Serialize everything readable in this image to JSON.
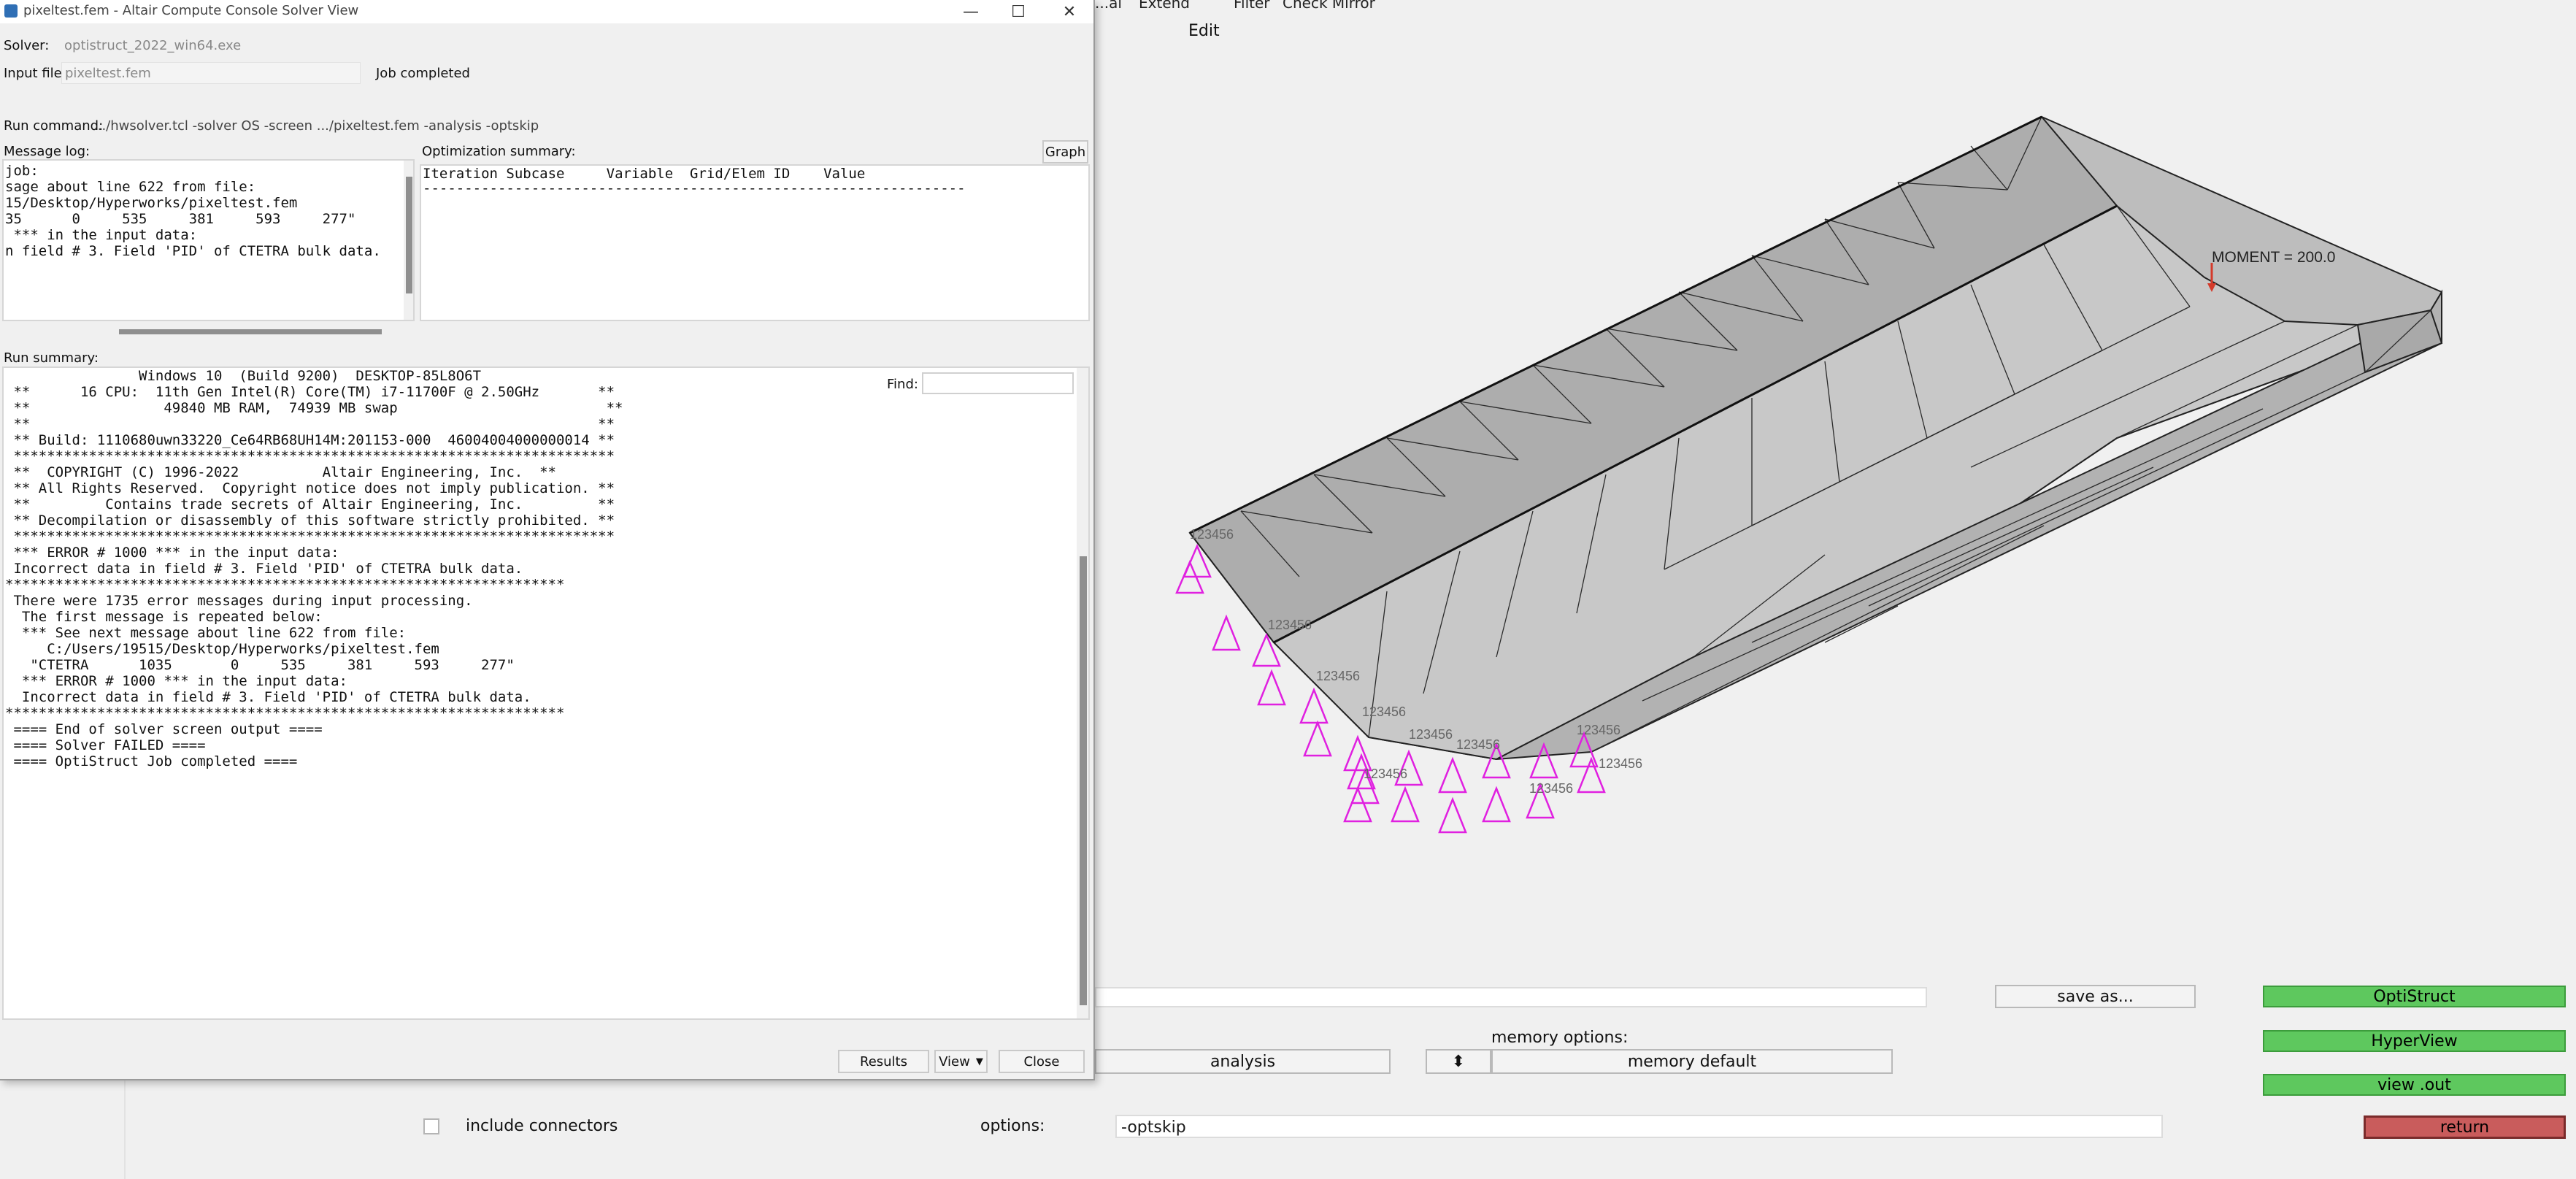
{
  "window": {
    "title": "pixeltest.fem - Altair Compute Console Solver View",
    "controls": {
      "minimize": "—",
      "maximize": "☐",
      "close": "✕"
    }
  },
  "header": {
    "solver_label": "Solver:",
    "solver_value": "optistruct_2022_win64.exe",
    "input_label": "Input file:",
    "input_value": "pixeltest.fem",
    "job_status": "Job completed",
    "run_command_label": "Run command:",
    "run_command_value": ".../hwsolver.tcl -solver OS -screen .../pixeltest.fem -analysis -optskip"
  },
  "message_log": {
    "label": "Message log:",
    "lines": [
      "job:",
      "",
      "",
      "sage about line 622 from file:",
      "15/Desktop/Hyperworks/pixeltest.fem",
      "35      0     535     381     593     277\"",
      "",
      " *** in the input data:",
      "n field # 3. Field 'PID' of CTETRA bulk data."
    ]
  },
  "optimization_summary": {
    "label": "Optimization summary:",
    "graph_button": "Graph",
    "header_line": "Iteration Subcase     Variable  Grid/Elem ID    Value",
    "separator": "-----------------------------------------------------------------"
  },
  "run_summary": {
    "label": "Run summary:",
    "find_label": "Find:",
    "find_value": "",
    "lines": [
      "                Windows 10  (Build 9200)  DESKTOP-85L8O6T",
      " **      16 CPU:  11th Gen Intel(R) Core(TM) i7-11700F @ 2.50GHz       **",
      " **                49840 MB RAM,  74939 MB swap                         **",
      " **                                                                    **",
      " ** Build: 1110680uwn33220_Ce64RB68UH14M:201153-000  46004004000000014 **",
      " ************************************************************************",
      " **  COPYRIGHT (C) 1996-2022          Altair Engineering, Inc.  **",
      " ** All Rights Reserved.  Copyright notice does not imply publication. **",
      " **         Contains trade secrets of Altair Engineering, Inc.         **",
      " ** Decompilation or disassembly of this software strictly prohibited. **",
      " ************************************************************************",
      "",
      "",
      " *** ERROR # 1000 *** in the input data:",
      " Incorrect data in field # 3. Field 'PID' of CTETRA bulk data.",
      "",
      "*******************************************************************",
      "",
      " There were 1735 error messages during input processing.",
      "  The first message is repeated below:",
      "",
      "",
      "  *** See next message about line 622 from file:",
      "     C:/Users/19515/Desktop/Hyperworks/pixeltest.fem",
      "   \"CTETRA      1035       0     535     381     593     277\"",
      "",
      "  *** ERROR # 1000 *** in the input data:",
      "  Incorrect data in field # 3. Field 'PID' of CTETRA bulk data.",
      "",
      "",
      "*******************************************************************",
      "",
      " ==== End of solver screen output ====",
      "",
      "",
      " ==== Solver FAILED ====",
      "",
      "",
      " ==== OptiStruct Job completed ===="
    ]
  },
  "bottom_buttons": {
    "results": "Results",
    "view": "View",
    "close": "Close"
  },
  "background_app": {
    "menu_items": [
      "...al",
      "Extend",
      "Filter",
      "Check Mirror"
    ],
    "edit_menu": "Edit",
    "moment_label": "MOMENT = 200.0",
    "node_labels": [
      "123456",
      "123456",
      "123456",
      "123456",
      "123456",
      "123456",
      "123456",
      "123456",
      "123456",
      "123456"
    ],
    "save_as": "save as...",
    "optistruct_button": "OptiStruct",
    "hyperview_button": "HyperView",
    "view_out_button": "view .out",
    "return_button": "return",
    "memory_options_label": "memory options:",
    "memory_default": "memory default",
    "analysis_value": "analysis",
    "include_connectors": "include connectors",
    "options_label": "options:",
    "options_value": "-optskip",
    "stepper_icon": "⬍"
  },
  "colors": {
    "accent_green": "#5ec85e",
    "return_red": "#c95c5c",
    "constraint_magenta": "#e020e0",
    "mesh_gray": "#b9b9b9"
  }
}
